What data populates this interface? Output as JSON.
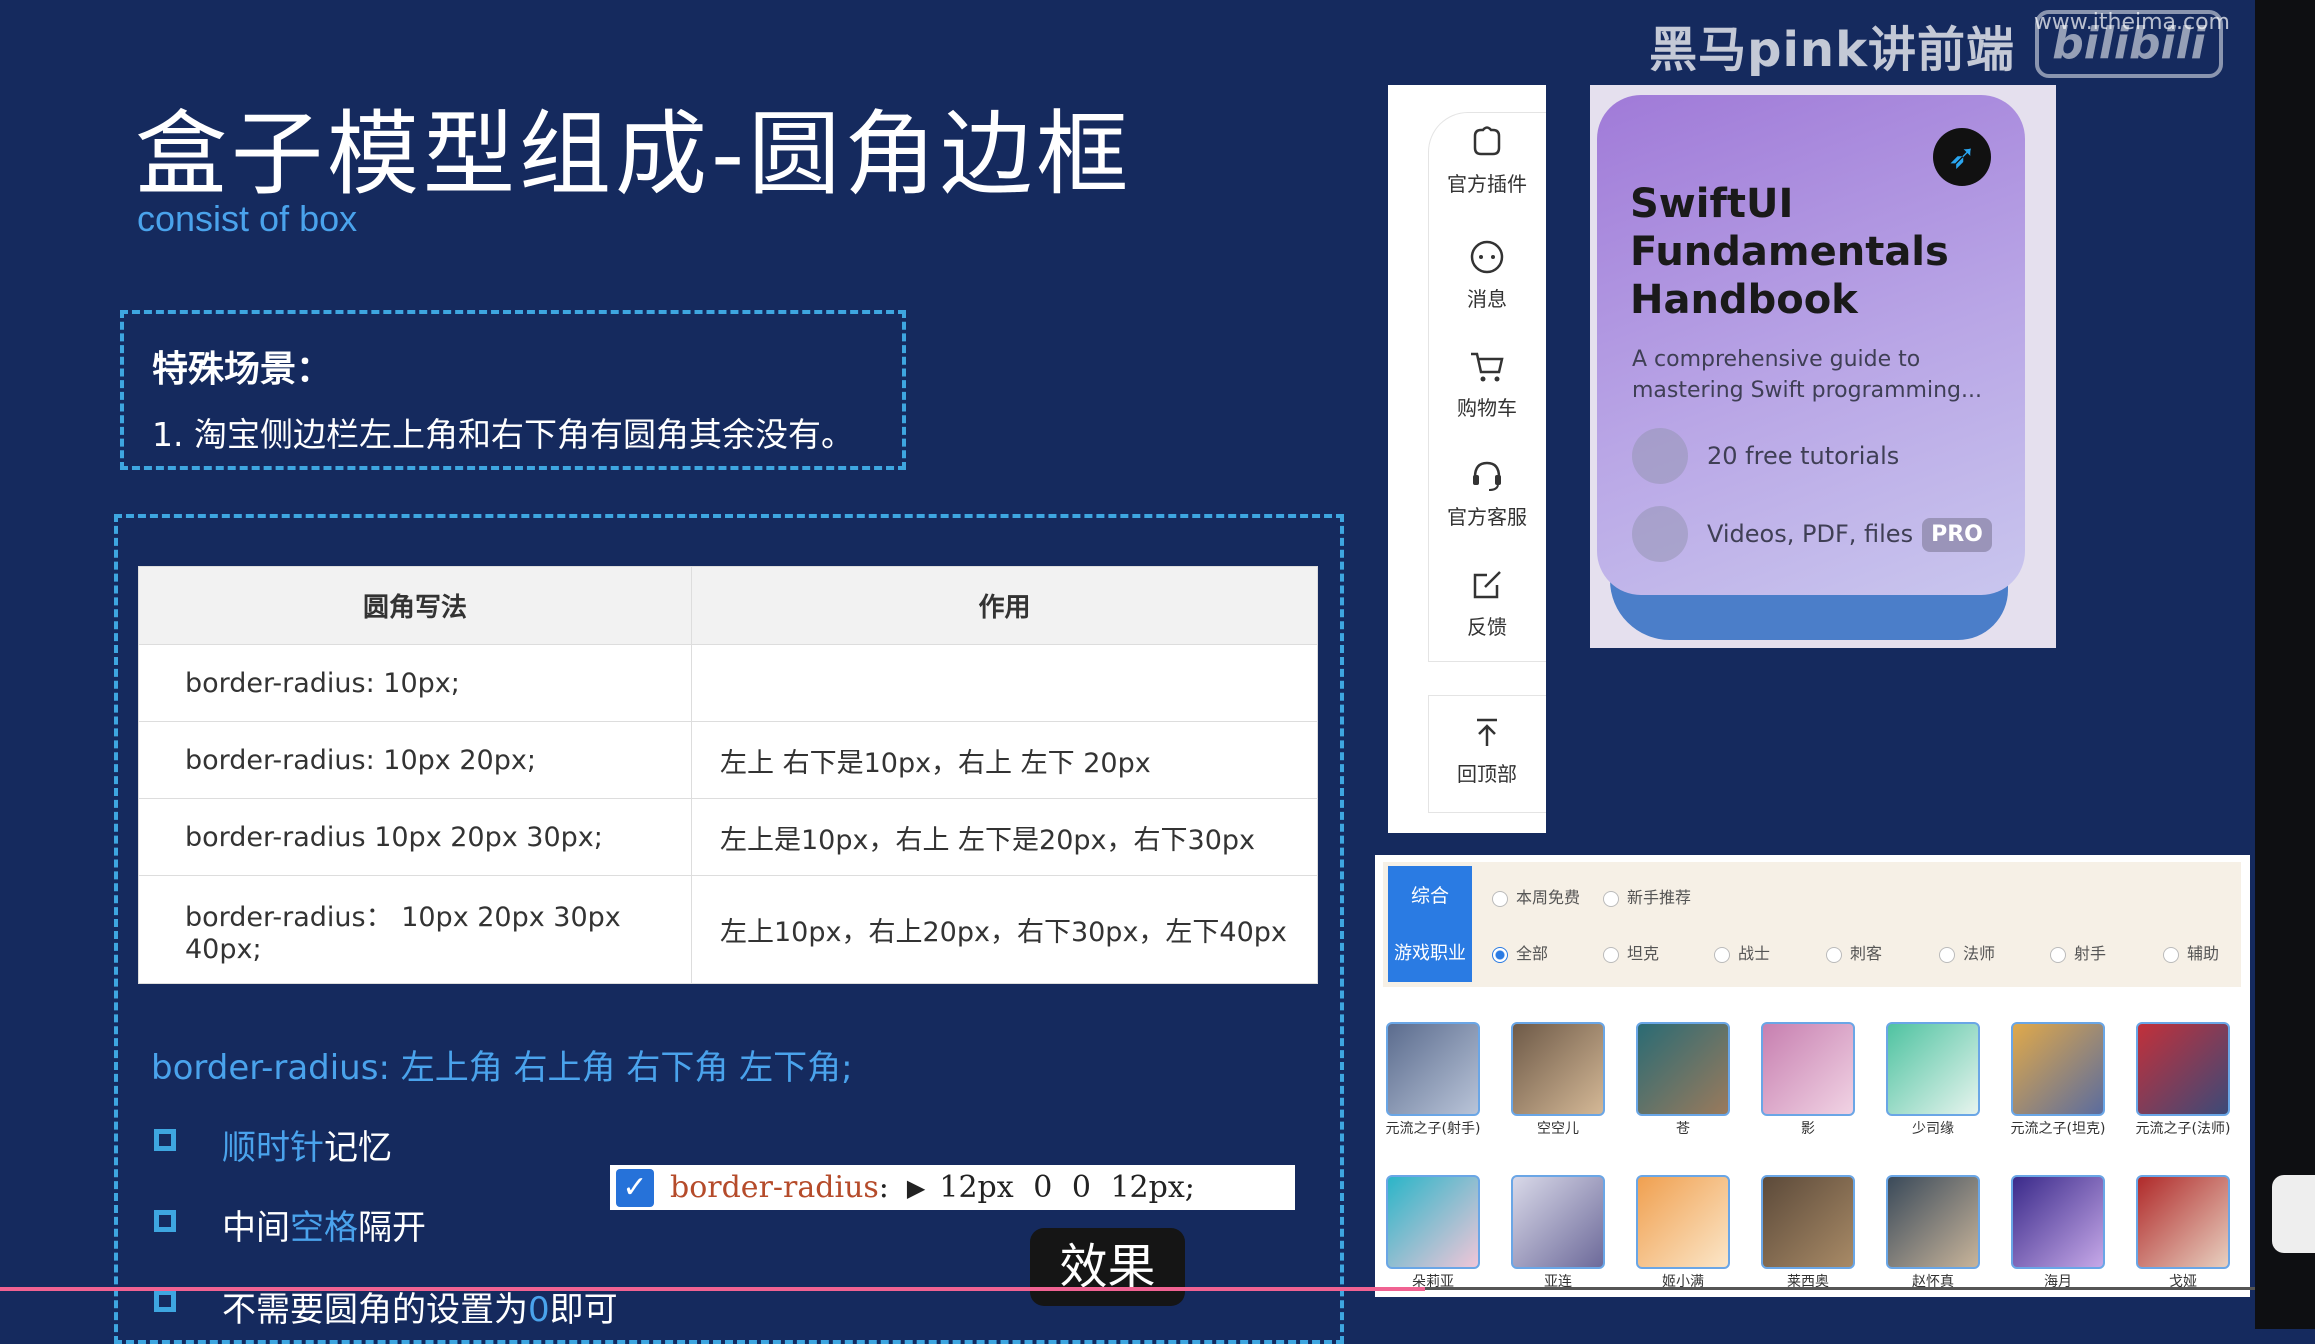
{
  "watermark": {
    "channel": "黑马pink讲前端",
    "site": "www.itheima.com",
    "bili": "bilibili"
  },
  "slide": {
    "title": "盒子模型组成-圆角边框",
    "subtitle": "consist of box",
    "scene_title": "特殊场景：",
    "scene_text": "1. 淘宝侧边栏左上角和右下角有圆角其余没有。",
    "table": {
      "headers": [
        "圆角写法",
        "作用"
      ],
      "rows": [
        [
          "border-radius: 10px;",
          ""
        ],
        [
          "border-radius: 10px 20px;",
          "左上  右下是10px，右上  左下 20px"
        ],
        [
          "border-radius 10px 20px 30px;",
          "左上是10px，右上 左下是20px，右下30px"
        ],
        [
          "border-radius：  10px 20px 30px 40px;",
          "左上10px，右上20px，右下30px，左下40px"
        ]
      ]
    },
    "syntax": "border-radius: 左上角 右上角 右下角 左下角;",
    "bullets": [
      {
        "hl": "顺时针",
        "rest": "记忆",
        "pre": ""
      },
      {
        "pre": "中间",
        "hl": "空格",
        "rest": "隔开"
      },
      {
        "pre": "不需要圆角的设置为",
        "hl": "0",
        "rest": "即可"
      }
    ],
    "code": {
      "prop": "border-radius",
      "colon": ":",
      "arrow": "▶",
      "value": "12px 0 0 12px;"
    },
    "effect_label": "效果"
  },
  "sidebar": {
    "items": [
      {
        "label": "官方插件",
        "icon": "plugin-icon"
      },
      {
        "label": "消息",
        "icon": "message-icon"
      },
      {
        "label": "购物车",
        "icon": "cart-icon"
      },
      {
        "label": "官方客服",
        "icon": "headset-icon"
      },
      {
        "label": "反馈",
        "icon": "feedback-icon"
      }
    ],
    "back_top": {
      "label": "回顶部",
      "icon": "arrow-top-icon"
    }
  },
  "card": {
    "title_lines": [
      "SwiftUI",
      "Fundamentals",
      "Handbook"
    ],
    "desc_lines": [
      "A comprehensive guide to",
      "mastering Swift programming..."
    ],
    "row1": "20 free tutorials",
    "row2": "Videos, PDF, files",
    "badge": "PRO",
    "colors": {
      "top": "#a07ad8",
      "bottom": "#c9c6ee",
      "shadow": "#4b7ec9"
    }
  },
  "heroes": {
    "tab1": "综合",
    "tab2": "游戏职业",
    "filter_row1": [
      "本周免费",
      "新手推荐"
    ],
    "filter_row2": [
      "全部",
      "坦克",
      "战士",
      "刺客",
      "法师",
      "射手",
      "辅助"
    ],
    "row1": [
      "元流之子(射手)",
      "空空儿",
      "苍",
      "影",
      "少司缘",
      "元流之子(坦克)",
      "元流之子(法师)"
    ],
    "row2": [
      "朵莉亚",
      "亚连",
      "姬小满",
      "莱西奥",
      "赵怀真",
      "海月",
      "戈娅"
    ]
  },
  "colors": {
    "slide_bg": "#152a5e",
    "accent": "#4aa3ec",
    "dashed": "#3ea6e0",
    "progress": "#f06292"
  }
}
